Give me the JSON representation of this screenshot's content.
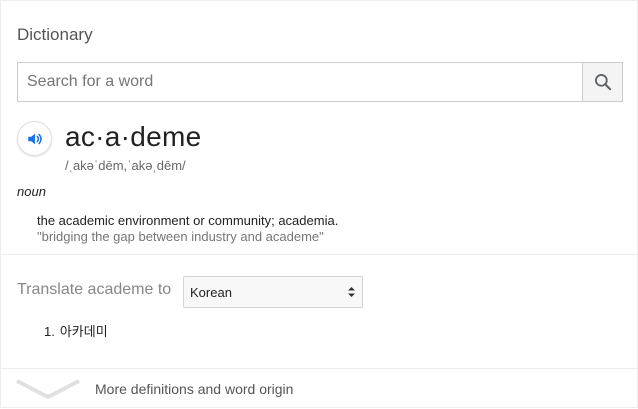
{
  "header": {
    "title": "Dictionary"
  },
  "search": {
    "placeholder": "Search for a word",
    "value": "",
    "icon": "search-icon"
  },
  "entry": {
    "word": "ac·a·deme",
    "phonetic": "/ˌakəˈdēm,ˈakəˌdēm/",
    "pronounce_icon": "speaker-icon",
    "part_of_speech": "noun",
    "definition": "the academic environment or community; academia.",
    "example": "\"bridging the gap between industry and academe\""
  },
  "translate": {
    "label": "Translate academe to",
    "selected_language": "Korean",
    "results": [
      {
        "number": "1.",
        "text": "아카데미"
      }
    ]
  },
  "footer": {
    "more_label": "More definitions and word origin",
    "icon": "chevron-down-icon"
  },
  "colors": {
    "accent_blue": "#1a73e8",
    "border": "#cccccc",
    "muted_text": "#878787"
  }
}
